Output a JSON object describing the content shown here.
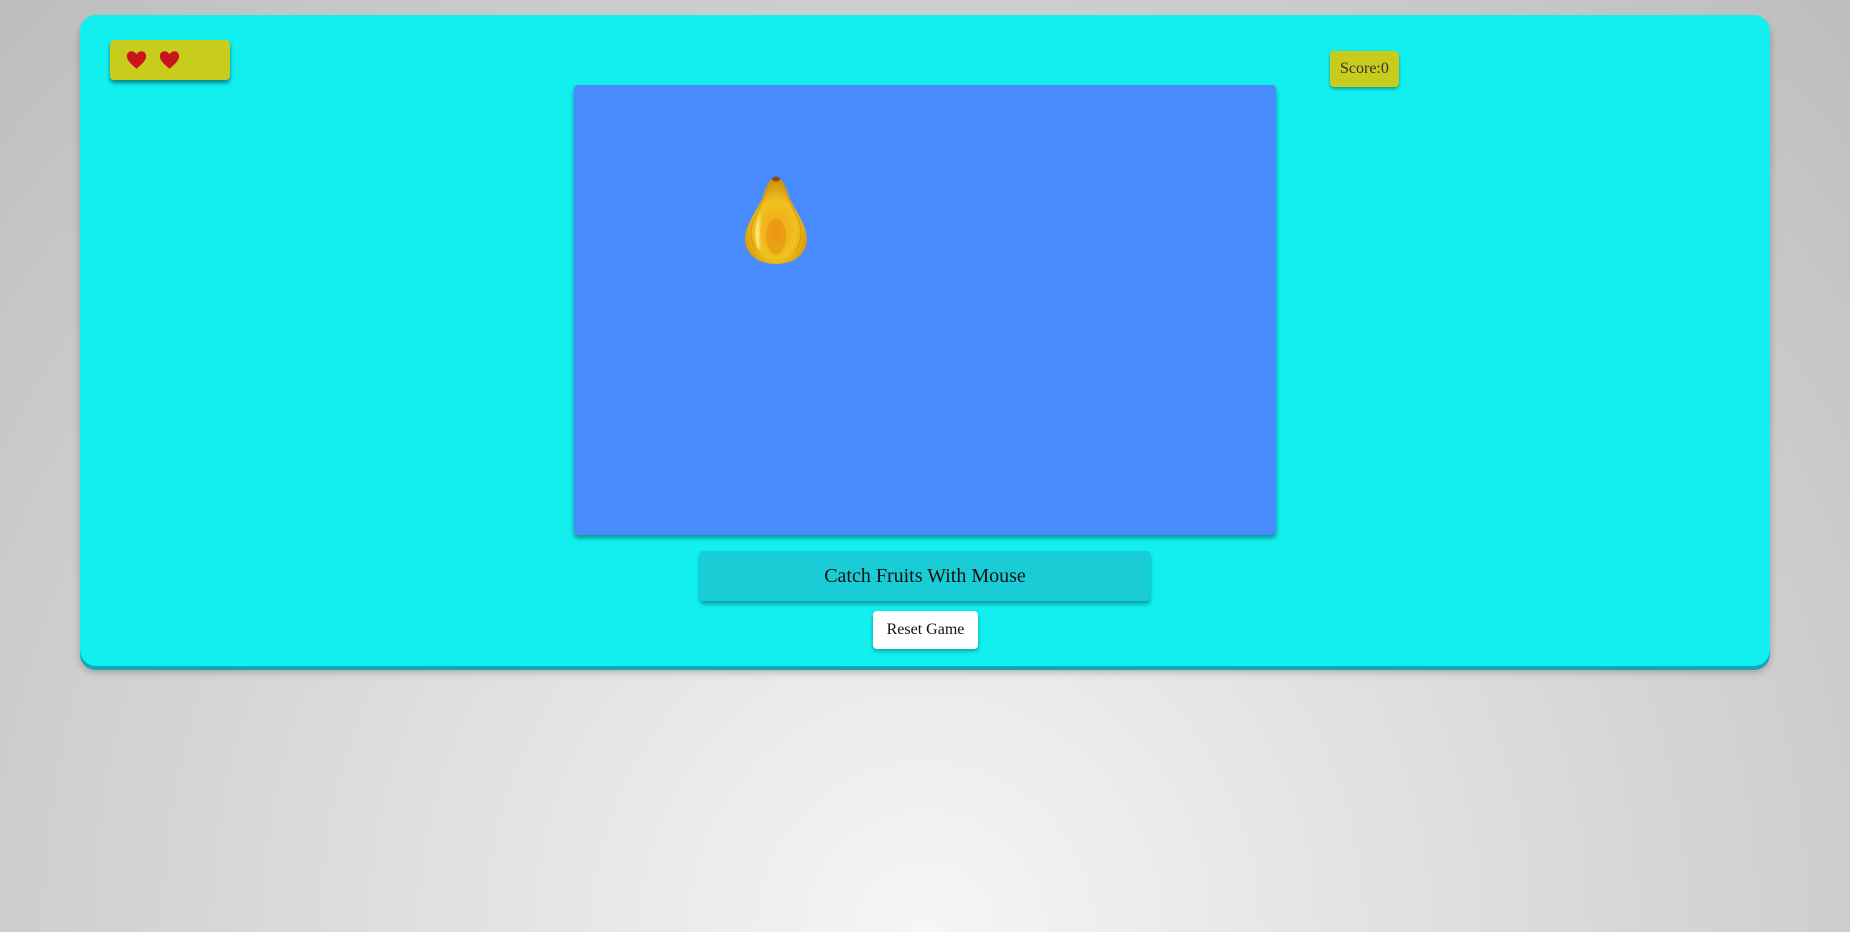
{
  "game": {
    "lives_remaining": 2,
    "lives_icon": "heart-icon",
    "score_text": "Score:0",
    "fruit_icon": "papaya-icon",
    "instruction_label": "Catch Fruits With Mouse",
    "reset_label": "Reset Game"
  },
  "colors": {
    "container_bg": "#11f0ef",
    "panel_yellow": "#c8cc1c",
    "play_area_bg": "#488bff",
    "instruction_bg": "#1accd6",
    "heart_red": "#c8141a"
  }
}
